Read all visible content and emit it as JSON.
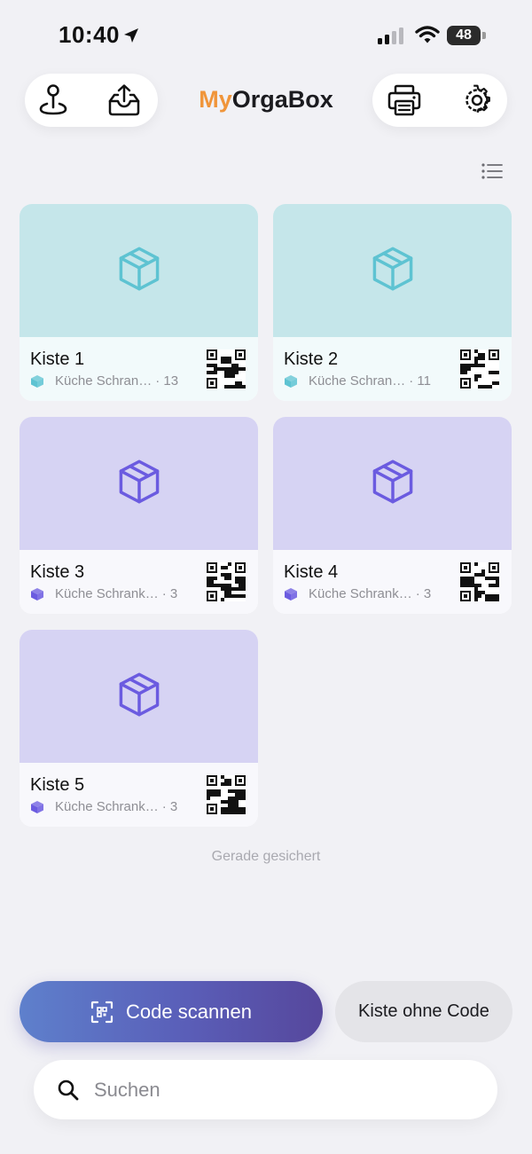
{
  "status_bar": {
    "time": "10:40",
    "battery": "48"
  },
  "header": {
    "brand_prefix": "My",
    "brand_suffix": "OrgaBox"
  },
  "colors": {
    "brand_orange": "#f0953a",
    "teal_card": "#c5e6ea",
    "teal_icon": "#5ec3d2",
    "violet_card": "#d6d3f3",
    "violet_icon": "#6b5be0"
  },
  "icons": {
    "left_pill": [
      "location-pin-icon",
      "export-tray-icon"
    ],
    "right_pill": [
      "printer-icon",
      "settings-gear-icon"
    ],
    "view_toggle": "list-view-icon"
  },
  "boxes": [
    {
      "title": "Kiste 1",
      "location": "Küche Schran…",
      "count": "· 13",
      "theme": "teal"
    },
    {
      "title": "Kiste 2",
      "location": "Küche Schran…",
      "count": "· 11",
      "theme": "teal"
    },
    {
      "title": "Kiste 3",
      "location": "Küche Schrank…",
      "count": "· 3",
      "theme": "violet"
    },
    {
      "title": "Kiste 4",
      "location": "Küche Schrank…",
      "count": "· 3",
      "theme": "violet"
    },
    {
      "title": "Kiste 5",
      "location": "Küche Schrank…",
      "count": "· 3",
      "theme": "violet"
    }
  ],
  "saved_status": "Gerade gesichert",
  "actions": {
    "scan_label": "Code scannen",
    "no_code_label": "Kiste ohne Code"
  },
  "search": {
    "placeholder": "Suchen",
    "value": ""
  }
}
